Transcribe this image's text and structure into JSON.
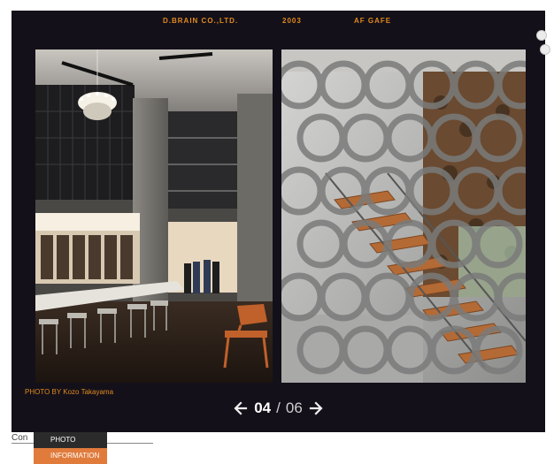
{
  "header": {
    "company": "D.BRAIN CO.,LTD.",
    "year": "2003",
    "project": "AF GAFE"
  },
  "credit": "PHOTO BY Kozo Takayama",
  "pager": {
    "current": "04",
    "separator": "/",
    "total": "06"
  },
  "bottom": {
    "label": "Con",
    "menu": [
      "PHOTO",
      "INFORMATION"
    ]
  },
  "colors": {
    "panel": "#141019",
    "accent": "#e08a1e",
    "menu_active": "#e07b3c",
    "menu_dark": "#2b2b2b"
  },
  "icons": [
    "arrow-left-icon",
    "arrow-right-icon"
  ]
}
